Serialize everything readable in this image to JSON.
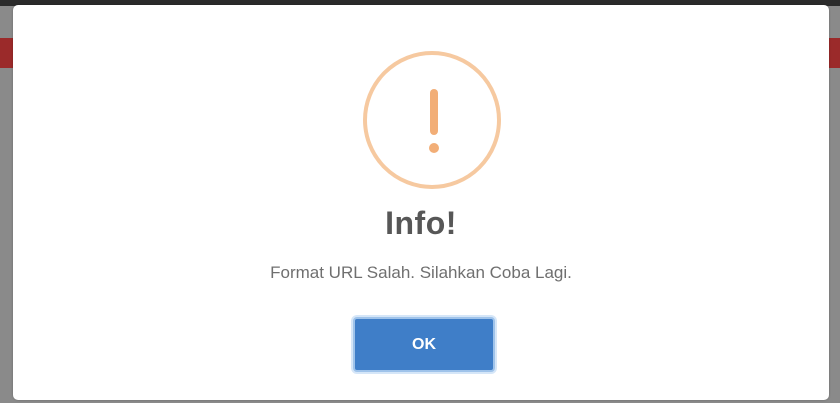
{
  "dialog": {
    "icon": "warning-exclamation-icon",
    "title": "Info!",
    "message": "Format URL Salah. Silahkan Coba Lagi.",
    "ok_label": "OK"
  },
  "colors": {
    "icon_accent": "#f2ae77",
    "icon_ring": "#f6c9a0",
    "button_primary": "#3f7ec8"
  }
}
